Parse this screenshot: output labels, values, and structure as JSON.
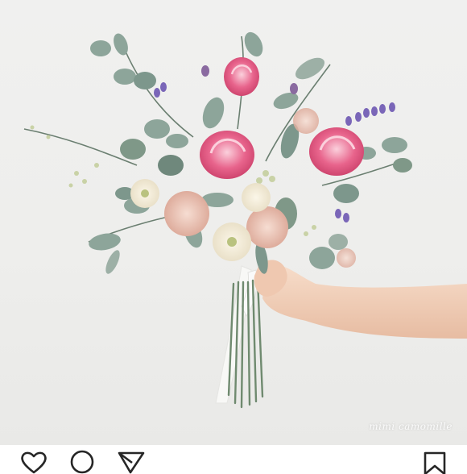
{
  "post": {
    "image_subject": "hand-holding-flower-bouquet",
    "watermark": "mimi camomille"
  },
  "actions": {
    "like": "heart-icon",
    "comment": "comment-icon",
    "share": "send-icon",
    "save": "bookmark-icon"
  },
  "colors": {
    "background": "#eeeeec",
    "eucalyptus": "#8da59a",
    "tulip_pink": "#e2577f",
    "hydrangea_peach": "#e3b4a5",
    "lavender": "#7a66b8",
    "icon": "#262626"
  }
}
